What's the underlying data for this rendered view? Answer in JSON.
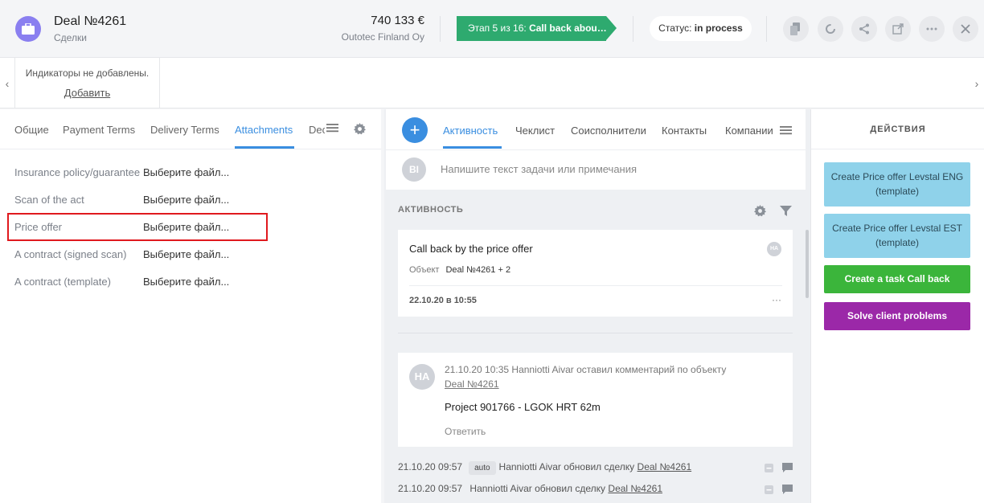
{
  "header": {
    "title": "Deal №4261",
    "subtitle": "Сделки",
    "amount": "740 133 €",
    "company": "Outotec Finland Oy",
    "stage_prefix": "Этап 5 из 16: ",
    "stage_name": "Call back abou…",
    "status_prefix": "Статус: ",
    "status_value": "in process"
  },
  "indicators": {
    "empty_text": "Индикаторы не добавлены.",
    "add_label": "Добавить"
  },
  "left_tabs": [
    "Общие",
    "Payment Terms",
    "Delivery Terms",
    "Attachments",
    "Dec"
  ],
  "active_left_tab": "Attachments",
  "attachments": [
    {
      "label": "Insurance policy/guarantee",
      "value": "Выберите файл..."
    },
    {
      "label": "Scan of the act",
      "value": "Выберите файл..."
    },
    {
      "label": "Price offer",
      "value": "Выберите файл..."
    },
    {
      "label": "A contract (signed scan)",
      "value": "Выберите файл..."
    },
    {
      "label": "A contract (template)",
      "value": "Выберите файл..."
    }
  ],
  "center_tabs": [
    "Активность",
    "Чеклист",
    "Соисполнители",
    "Контакты",
    "Компании"
  ],
  "active_center_tab": "Активность",
  "note": {
    "avatar": "BI",
    "placeholder": "Напишите текст задачи или примечания"
  },
  "activity": {
    "header": "АКТИВНОСТЬ",
    "task": {
      "title": "Call back by the price offer",
      "object_label": "Объект",
      "object_value": "Deal №4261 + 2",
      "date": "22.10.20 в 10:55",
      "assignee_avatar": "HA",
      "more": "···"
    },
    "comment": {
      "avatar": "HA",
      "meta": "21.10.20 10:35 Hanniotti Aivar оставил комментарий по объекту",
      "link": "Deal №4261",
      "text": "Project 901766 - LGOK HRT 62m",
      "reply": "Ответить"
    },
    "log": [
      {
        "time": "21.10.20 09:57",
        "badge": "auto",
        "text": "Hanniotti Aivar обновил сделку",
        "link": "Deal №4261"
      },
      {
        "time": "21.10.20 09:57",
        "badge": "",
        "text": "Hanniotti Aivar обновил сделку",
        "link": "Deal №4261"
      }
    ]
  },
  "actions": {
    "title": "ДЕЙСТВИЯ",
    "buttons": [
      {
        "label": "Create Price offer Levstal ENG (template)",
        "style": "light"
      },
      {
        "label": "Create Price offer Levstal EST (template)",
        "style": "light"
      },
      {
        "label": "Create a task Call back",
        "style": "green"
      },
      {
        "label": "Solve client problems",
        "style": "purple"
      }
    ]
  },
  "colors": {
    "accent": "#3a8ee0",
    "stage": "#2eaa6f",
    "deal_icon": "#8a7ff0",
    "highlight": "#e0191e",
    "action_light": "#8fd2ea",
    "action_green": "#3bb53b",
    "action_purple": "#9b28a8"
  }
}
